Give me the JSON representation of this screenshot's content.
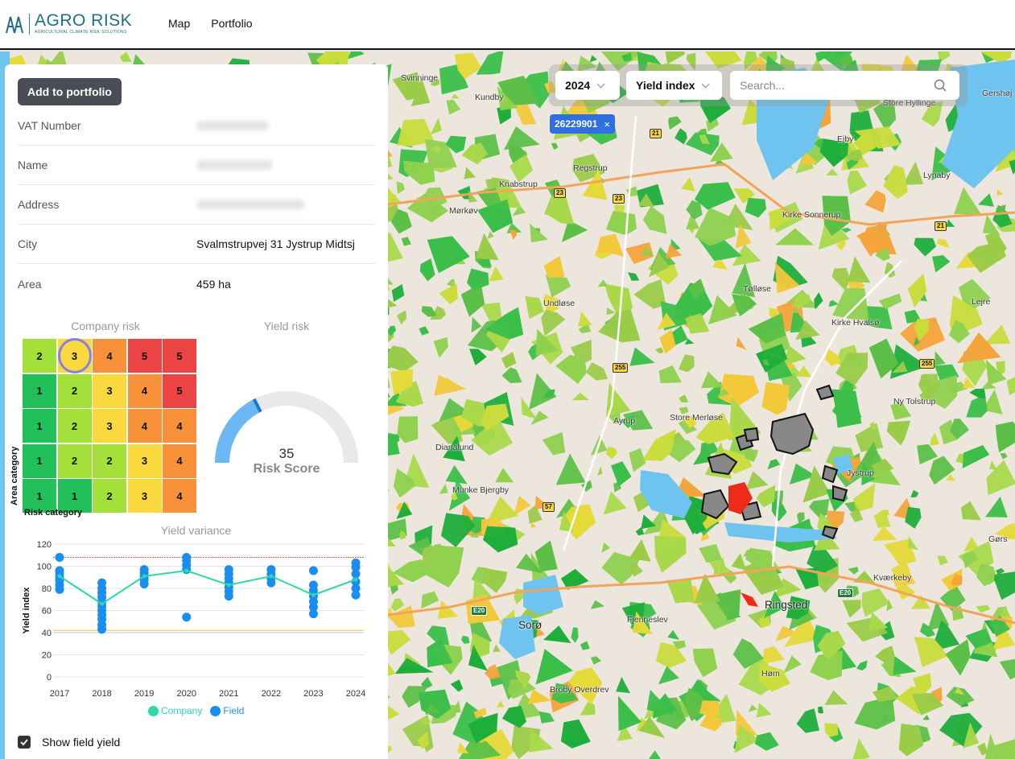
{
  "app": {
    "logo_title": "AGRO RISK",
    "logo_subtitle": "AGRICULTURAL CLIMATE RISK SOLUTIONS"
  },
  "nav": {
    "items": [
      {
        "label": "Map"
      },
      {
        "label": "Portfolio"
      }
    ]
  },
  "filters": {
    "year": "2024",
    "layer": "Yield index",
    "search_placeholder": "Search...",
    "chip": "26229901",
    "chip_close": "×"
  },
  "panel": {
    "add_button": "Add to portfolio",
    "rows": [
      {
        "label": "VAT Number",
        "value": "",
        "blurred": true
      },
      {
        "label": "Name",
        "value": "",
        "blurred": true
      },
      {
        "label": "Address",
        "value": "",
        "blurred": true
      },
      {
        "label": "City",
        "value": "Svalmstrupvej 31 Jystrup Midtsj"
      },
      {
        "label": "Area",
        "value": "459 ha"
      }
    ],
    "company_risk_title": "Company risk",
    "yield_risk_title": "Yield risk",
    "matrix": [
      [
        2,
        3,
        4,
        5,
        5
      ],
      [
        1,
        2,
        3,
        4,
        5
      ],
      [
        1,
        2,
        3,
        4,
        4
      ],
      [
        1,
        2,
        2,
        3,
        4
      ],
      [
        1,
        1,
        2,
        3,
        4
      ]
    ],
    "matrix_selected": {
      "row": 0,
      "col": 1
    },
    "matrix_y_label": "Area category",
    "matrix_x_label": "Risk category",
    "gauge": {
      "value": "35",
      "label": "Risk Score",
      "fraction": 0.35
    },
    "variance_title": "Yield variance",
    "show_field_yield": "Show field yield",
    "show_field_yield_checked": true
  },
  "colors": {
    "risk1": "#22c05a",
    "risk2": "#a4e03a",
    "risk3": "#fad93e",
    "risk4": "#f7923a",
    "risk5": "#ea4444",
    "company": "#2ed8a8",
    "field": "#1a8ef0",
    "chip": "#2f6fe0",
    "gauge_fill": "#6cb8f5",
    "gauge_track": "#e9e9e9"
  },
  "icons": {
    "search": "search-icon",
    "close": "close-icon",
    "chevron": "chevron-down-icon",
    "check": "check-icon"
  },
  "chart_data": {
    "type": "scatter",
    "title": "Yield variance",
    "xlabel": "",
    "ylabel": "Yield index",
    "ylim": [
      0,
      120
    ],
    "yticks": [
      0,
      20,
      40,
      60,
      80,
      100,
      120
    ],
    "categories": [
      "2017",
      "2018",
      "2019",
      "2020",
      "2021",
      "2022",
      "2023",
      "2024"
    ],
    "reference_lines": [
      108,
      42,
      40
    ],
    "series": [
      {
        "name": "Company",
        "type": "line",
        "values": [
          91,
          66,
          91,
          96,
          83,
          91,
          74,
          88
        ]
      },
      {
        "name": "Field",
        "type": "scatter",
        "points": [
          [
            0,
            108
          ],
          [
            0,
            96
          ],
          [
            0,
            93
          ],
          [
            0,
            90
          ],
          [
            0,
            87
          ],
          [
            0,
            83
          ],
          [
            0,
            79
          ],
          [
            1,
            85
          ],
          [
            1,
            80
          ],
          [
            1,
            76
          ],
          [
            1,
            72
          ],
          [
            1,
            68
          ],
          [
            1,
            64
          ],
          [
            1,
            60
          ],
          [
            1,
            56
          ],
          [
            1,
            52
          ],
          [
            1,
            47
          ],
          [
            1,
            43
          ],
          [
            2,
            97
          ],
          [
            2,
            94
          ],
          [
            2,
            91
          ],
          [
            2,
            88
          ],
          [
            2,
            84
          ],
          [
            3,
            108
          ],
          [
            3,
            105
          ],
          [
            3,
            101
          ],
          [
            3,
            97
          ],
          [
            3,
            54
          ],
          [
            4,
            97
          ],
          [
            4,
            93
          ],
          [
            4,
            89
          ],
          [
            4,
            85
          ],
          [
            4,
            81
          ],
          [
            4,
            77
          ],
          [
            4,
            73
          ],
          [
            5,
            97
          ],
          [
            5,
            93
          ],
          [
            5,
            89
          ],
          [
            5,
            85
          ],
          [
            6,
            96
          ],
          [
            6,
            83
          ],
          [
            6,
            78
          ],
          [
            6,
            73
          ],
          [
            6,
            68
          ],
          [
            6,
            63
          ],
          [
            6,
            57
          ],
          [
            7,
            103
          ],
          [
            7,
            99
          ],
          [
            7,
            93
          ],
          [
            7,
            86
          ],
          [
            7,
            80
          ],
          [
            7,
            74
          ]
        ]
      }
    ],
    "legend": "bottom"
  }
}
